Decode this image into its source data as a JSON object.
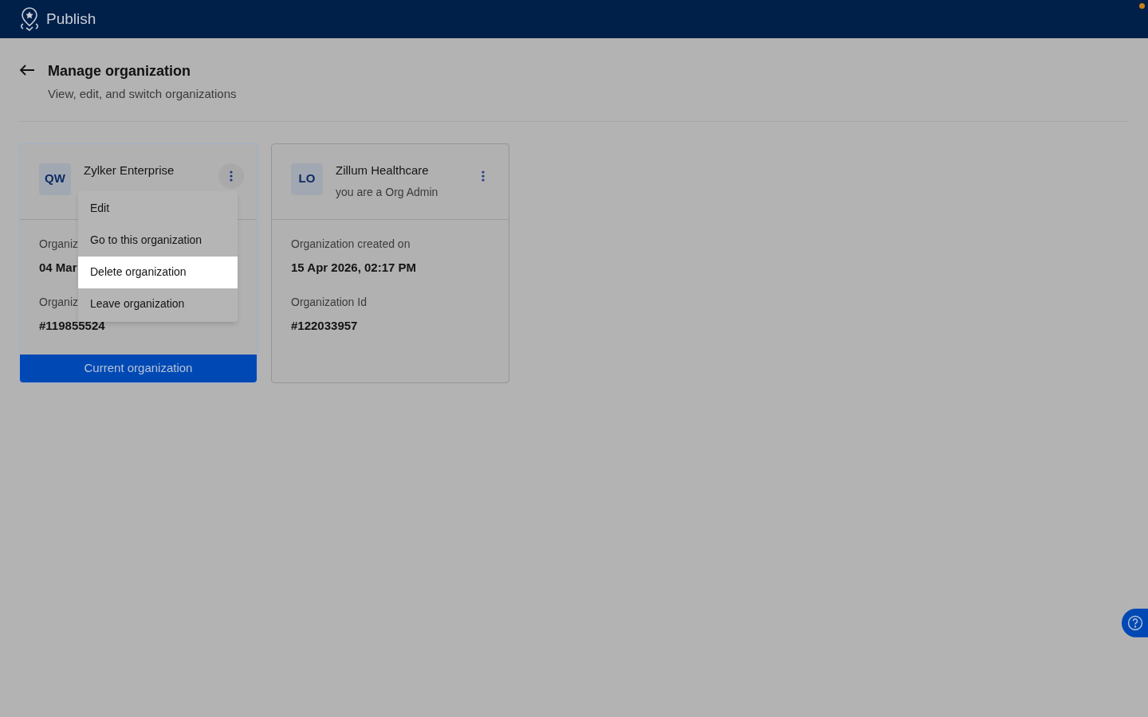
{
  "app": {
    "name": "Publish"
  },
  "page": {
    "title": "Manage organization",
    "subtitle": "View, edit, and switch organizations"
  },
  "organizations": [
    {
      "initials": "QW",
      "name": "Zylker Enterprise",
      "current": true,
      "current_label": "Current organization",
      "fields": [
        {
          "label": "Organiz",
          "value": "04 Mar"
        },
        {
          "label": "Organiz",
          "value": "#119855524"
        }
      ],
      "menu": [
        {
          "label": "Edit",
          "selected": false
        },
        {
          "label": "Go to this organization",
          "selected": false
        },
        {
          "label": "Delete organization",
          "selected": true
        },
        {
          "label": "Leave organization",
          "selected": false
        }
      ]
    },
    {
      "initials": "LO",
      "name": "Zillum Healthcare",
      "role": "you are a Org Admin",
      "current": false,
      "fields": [
        {
          "label": "Organization created on",
          "value": "15 Apr 2026, 02:17 PM"
        },
        {
          "label": "Organization Id",
          "value": "#122033957"
        }
      ]
    }
  ]
}
